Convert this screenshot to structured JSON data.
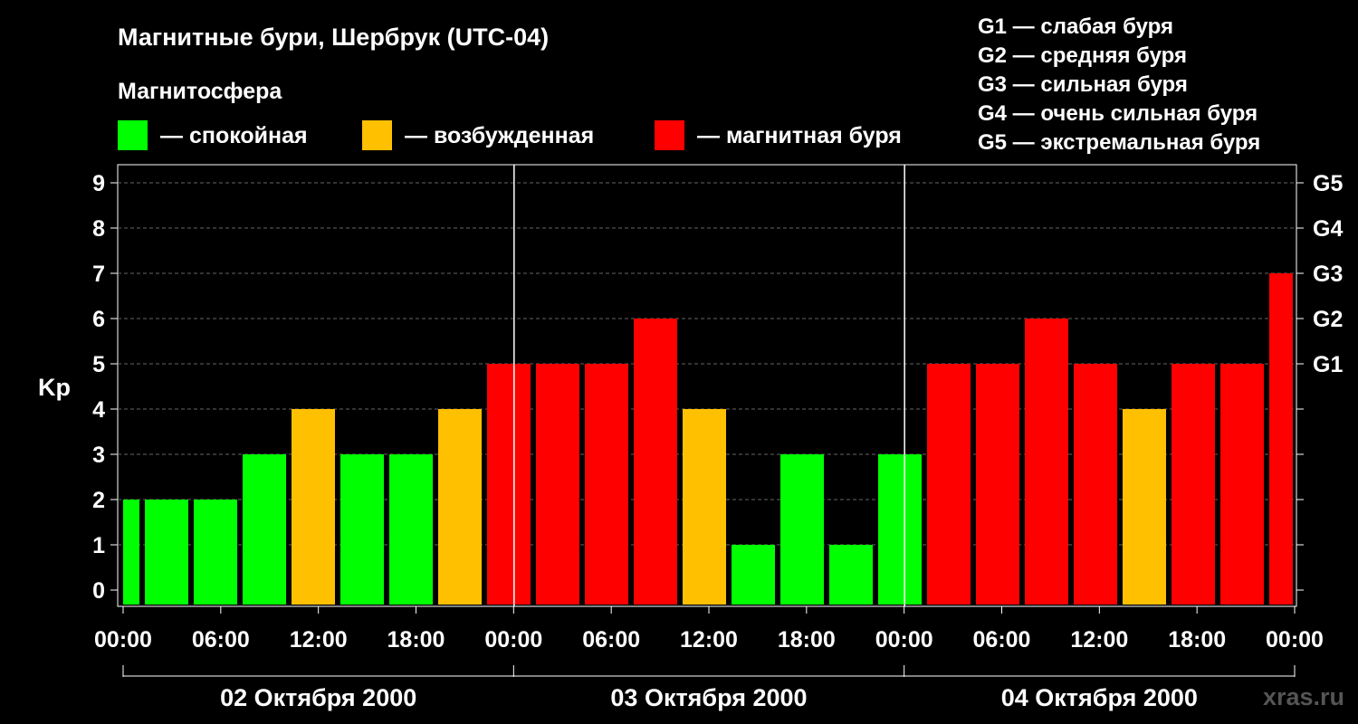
{
  "chart_data": {
    "type": "bar",
    "title": "Магнитные бури, Шербрук (UTC-04)",
    "subtitle": "Магнитосфера",
    "ylabel": "Kp",
    "ylim": [
      0,
      9
    ],
    "yticks": [
      "0",
      "1",
      "2",
      "3",
      "4",
      "5",
      "6",
      "7",
      "8",
      "9"
    ],
    "g_levels": [
      {
        "label": "G1",
        "kp": 5
      },
      {
        "label": "G2",
        "kp": 6
      },
      {
        "label": "G3",
        "kp": 7
      },
      {
        "label": "G4",
        "kp": 8
      },
      {
        "label": "G5",
        "kp": 9
      }
    ],
    "legend": [
      {
        "label": "— спокойная",
        "color": "#00ff00"
      },
      {
        "label": "— возбужденная",
        "color": "#ffc000"
      },
      {
        "label": "— магнитная буря",
        "color": "#ff0000"
      }
    ],
    "g_legend": [
      "G1 — слабая буря",
      "G2 — средняя буря",
      "G3 — сильная буря",
      "G4 — очень сильная буря",
      "G5 — экстремальная буря"
    ],
    "xticks": [
      "00:00",
      "06:00",
      "12:00",
      "18:00",
      "00:00",
      "06:00",
      "12:00",
      "18:00",
      "00:00",
      "06:00",
      "12:00",
      "18:00",
      "00:00"
    ],
    "days": [
      "02 Октября 2000",
      "03 Октября 2000",
      "04 Октября 2000"
    ],
    "values": [
      2,
      2,
      2,
      3,
      4,
      3,
      3,
      4,
      5,
      5,
      5,
      6,
      4,
      1,
      3,
      1,
      3,
      5,
      5,
      6,
      5,
      4,
      5,
      5,
      7
    ],
    "watermark": "xras.ru"
  }
}
